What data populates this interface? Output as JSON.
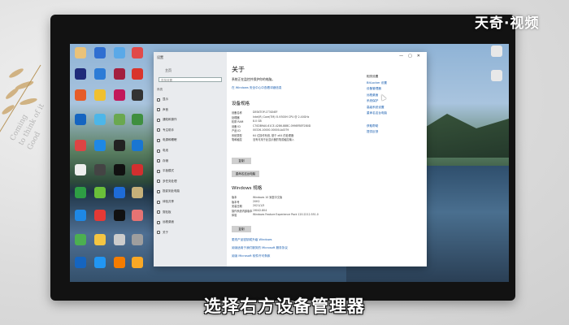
{
  "watermark": "天奇·视频",
  "caption": "选择右方设备管理器",
  "background_text": [
    "Coming",
    "to think of it",
    "Good"
  ],
  "settings": {
    "window_title": "设置",
    "home": "主页",
    "search_placeholder": "查找设置",
    "group": "系统",
    "nav": [
      "显示",
      "声音",
      "通知和操作",
      "专注助手",
      "电源和睡眠",
      "电池",
      "存储",
      "平板模式",
      "多任务处理",
      "投影到此电脑",
      "体验共享",
      "剪贴板",
      "远程桌面",
      "关于"
    ],
    "title": "关于",
    "protect_text": "系统正在监控并保护你的电脑。",
    "security_link": "在 Windows 安全中心中查看详细信息",
    "device_spec_title": "设备规格",
    "device_specs": [
      [
        "设备名称",
        "DESKTOP-1T3GNEF"
      ],
      [
        "处理器",
        "Intel(R) Core(TM) i5-9300H CPU @ 2.40GHz"
      ],
      [
        "机带 RAM",
        "8.0 GB"
      ],
      [
        "设备 ID",
        "C70DB9A0-61CE-4286-88BC-0998FBEF2B0D"
      ],
      [
        "产品 ID",
        "00326-10000-00000-AA379"
      ],
      [
        "系统类型",
        "64 位操作系统, 基于 x64 的处理器"
      ],
      [
        "笔和触控",
        "没有可用于此显示器的笔或触控输入"
      ]
    ],
    "copy_button": "复制",
    "rename_button": "重命名这台电脑",
    "windows_spec_title": "Windows 规格",
    "windows_specs": [
      [
        "版本",
        "Windows 10 家庭中文版"
      ],
      [
        "版本号",
        "20H2"
      ],
      [
        "安装日期",
        "2021/1/5"
      ],
      [
        "操作系统内部版本",
        "19042.804"
      ],
      [
        "体验",
        "Windows Feature Experience Pack 120.2212.551.0"
      ]
    ],
    "copy_button_2": "复制",
    "bottom_links": [
      "更改产品密钥或升级 Windows",
      "阅读适用于我们服务的 Microsoft 服务协议",
      "阅读 Microsoft 软件许可条款"
    ],
    "related_title": "相关设置",
    "related_links": [
      "BitLocker 设置",
      "设备管理器",
      "远程桌面",
      "系统保护",
      "高级系统设置",
      "重命名这台电脑"
    ],
    "help_links": [
      "获取帮助",
      "提供反馈"
    ]
  }
}
